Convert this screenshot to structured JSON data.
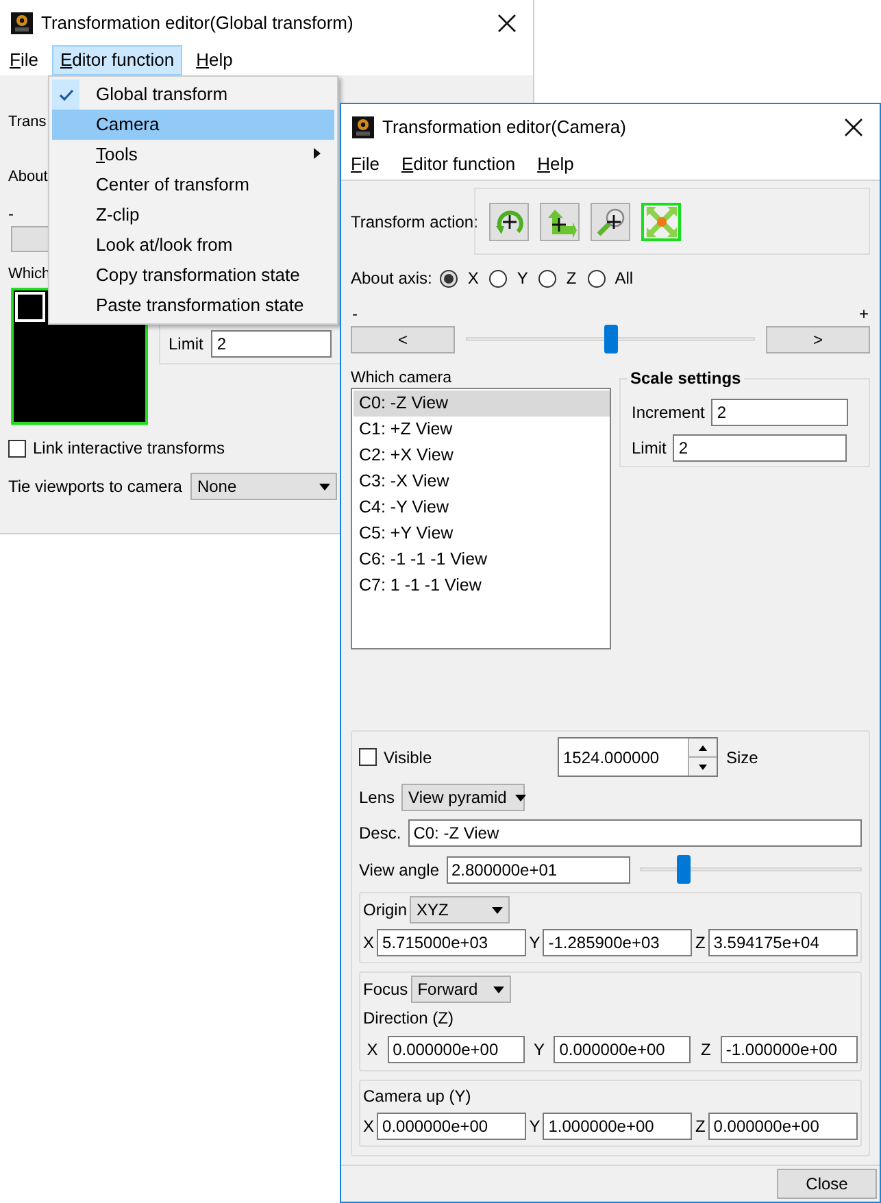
{
  "back_window": {
    "title": "Transformation editor(Global transform)",
    "menu": [
      {
        "label": "File",
        "selected": false,
        "mnemonic": true
      },
      {
        "label": "Editor function",
        "selected": true,
        "mnemonic": true
      },
      {
        "label": "Help",
        "selected": false,
        "mnemonic": true
      }
    ],
    "transform_label": "Trans",
    "about_label": "About",
    "slider_minus": "-",
    "which_label": "Which",
    "limit": {
      "label": "Limit",
      "value": "2"
    },
    "link_checkbox": {
      "label": "Link interactive transforms",
      "checked": false
    },
    "tie_viewports": {
      "label": "Tie viewports to camera",
      "value": "None"
    }
  },
  "editor_function_menu": {
    "items": [
      {
        "label": "Global transform",
        "checked": true,
        "selected": false,
        "submenu": false,
        "mnemonic": false
      },
      {
        "label": "Camera",
        "checked": false,
        "selected": true,
        "submenu": false,
        "mnemonic": false
      },
      {
        "label": "Tools",
        "checked": false,
        "selected": false,
        "submenu": true,
        "mnemonic": true
      },
      {
        "label": "Center of transform",
        "checked": false,
        "selected": false,
        "submenu": false,
        "mnemonic": false
      },
      {
        "label": "Z-clip",
        "checked": false,
        "selected": false,
        "submenu": false,
        "mnemonic": false
      },
      {
        "label": "Look at/look from",
        "checked": false,
        "selected": false,
        "submenu": false,
        "mnemonic": false
      },
      {
        "label": "Copy transformation state",
        "checked": false,
        "selected": false,
        "submenu": false,
        "mnemonic": false
      },
      {
        "label": "Paste transformation state",
        "checked": false,
        "selected": false,
        "submenu": false,
        "mnemonic": false
      }
    ]
  },
  "front_window": {
    "title": "Transformation editor(Camera)",
    "menu": [
      {
        "label": "File",
        "selected": false,
        "mnemonic": true
      },
      {
        "label": "Editor function",
        "selected": false,
        "mnemonic": true
      },
      {
        "label": "Help",
        "selected": false,
        "mnemonic": true
      }
    ],
    "transform_action": {
      "label": "Transform action:",
      "tools": [
        {
          "kind": "rotate",
          "selected": false
        },
        {
          "kind": "translate",
          "selected": false
        },
        {
          "kind": "zoom",
          "selected": false
        },
        {
          "kind": "scale",
          "selected": true
        }
      ]
    },
    "about_axis": {
      "label": "About axis:",
      "options": [
        {
          "label": "X",
          "selected": true
        },
        {
          "label": "Y",
          "selected": false
        },
        {
          "label": "Z",
          "selected": false
        },
        {
          "label": "All",
          "selected": false
        }
      ]
    },
    "slider_minus": "-",
    "slider_plus": "+",
    "step_left": "<",
    "step_right": ">",
    "slider": {
      "level": 0.5
    },
    "which_camera": {
      "label": "Which camera",
      "items": [
        {
          "label": "C0: -Z View",
          "selected": true
        },
        {
          "label": "C1: +Z View",
          "selected": false
        },
        {
          "label": "C2: +X View",
          "selected": false
        },
        {
          "label": "C3: -X View",
          "selected": false
        },
        {
          "label": "C4: -Y View",
          "selected": false
        },
        {
          "label": "C5: +Y View",
          "selected": false
        },
        {
          "label": "C6: -1 -1 -1 View",
          "selected": false
        },
        {
          "label": "C7: 1 -1 -1 View",
          "selected": false
        }
      ]
    },
    "scale_settings": {
      "title": "Scale settings",
      "increment": {
        "label": "Increment",
        "value": "2"
      },
      "limit": {
        "label": "Limit",
        "value": "2"
      }
    },
    "visible": {
      "label": "Visible",
      "checked": false
    },
    "size": {
      "value": "1524.000000",
      "label": "Size"
    },
    "lens": {
      "label": "Lens",
      "value": "View pyramid"
    },
    "desc": {
      "label": "Desc.",
      "value": "C0: -Z View"
    },
    "view_angle": {
      "label": "View angle",
      "value": "2.800000e+01",
      "level": 0.2
    },
    "origin": {
      "label": "Origin",
      "mode": "XYZ",
      "coords": [
        {
          "axis": "X",
          "value": "5.715000e+03"
        },
        {
          "axis": "Y",
          "value": "-1.285900e+03"
        },
        {
          "axis": "Z",
          "value": "3.594175e+04"
        }
      ]
    },
    "focus": {
      "label": "Focus",
      "mode": "Forward",
      "direction_label": "Direction (Z)",
      "coords": [
        {
          "axis": "X",
          "value": "0.000000e+00"
        },
        {
          "axis": "Y",
          "value": "0.000000e+00"
        },
        {
          "axis": "Z",
          "value": "-1.000000e+00"
        }
      ]
    },
    "camera_up": {
      "label": "Camera up (Y)",
      "coords": [
        {
          "axis": "X",
          "value": "0.000000e+00"
        },
        {
          "axis": "Y",
          "value": "1.000000e+00"
        },
        {
          "axis": "Z",
          "value": "0.000000e+00"
        }
      ]
    },
    "close_button": "Close"
  }
}
